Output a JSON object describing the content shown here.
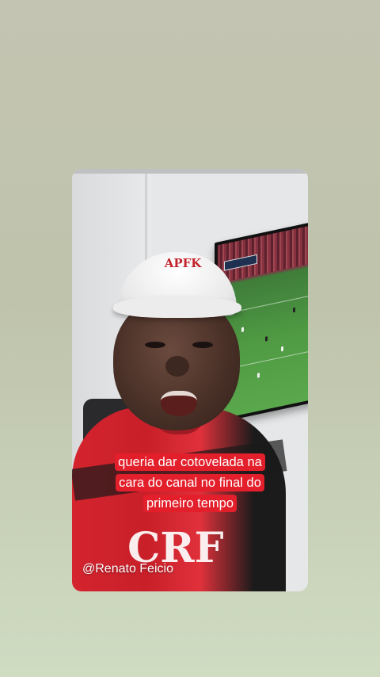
{
  "story": {
    "caption": "queria dar cotovelada na cara do canal no final do primeiro tempo",
    "handle": "@Renato Feicio",
    "cap_logo": "APFK",
    "crest": "CRF"
  },
  "colors": {
    "caption_bg": "#e21f2a",
    "background_top": "#c3c4b2",
    "background_bottom": "#cfdcc2"
  },
  "icons": {
    "cap_logo": "cap-logo-icon",
    "crest": "flamengo-crest-icon"
  }
}
